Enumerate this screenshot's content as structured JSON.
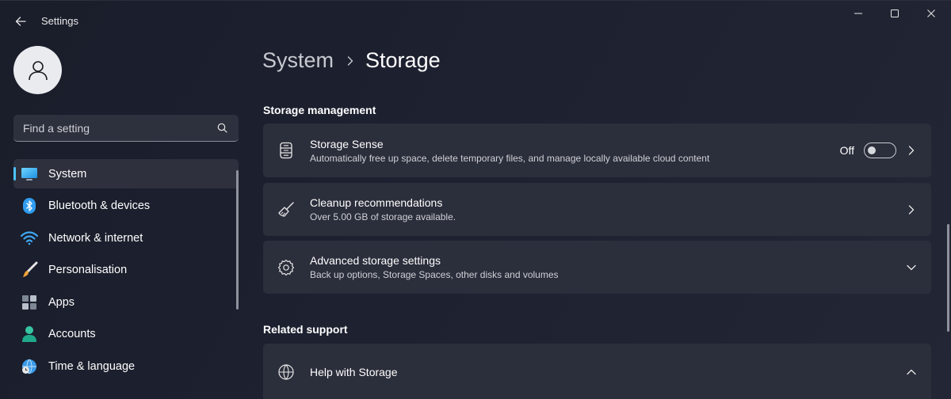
{
  "window": {
    "title": "Settings",
    "controls": [
      "minimize-icon",
      "maximize-icon",
      "close-icon"
    ]
  },
  "sidebar": {
    "search": {
      "placeholder": "Find a setting"
    },
    "items": [
      {
        "label": "System",
        "icon": "monitor-icon",
        "selected": true
      },
      {
        "label": "Bluetooth & devices",
        "icon": "bluetooth-icon",
        "selected": false
      },
      {
        "label": "Network & internet",
        "icon": "wifi-icon",
        "selected": false
      },
      {
        "label": "Personalisation",
        "icon": "paintbrush-icon",
        "selected": false
      },
      {
        "label": "Apps",
        "icon": "apps-icon",
        "selected": false
      },
      {
        "label": "Accounts",
        "icon": "account-icon",
        "selected": false
      },
      {
        "label": "Time & language",
        "icon": "globe-clock-icon",
        "selected": false
      }
    ]
  },
  "breadcrumb": {
    "parent": "System",
    "current": "Storage"
  },
  "storage_management": {
    "heading": "Storage management",
    "storage_sense": {
      "title": "Storage Sense",
      "subtitle": "Automatically free up space, delete temporary files, and manage locally available cloud content",
      "toggle_label": "Off",
      "toggle_on": false
    },
    "cleanup": {
      "title": "Cleanup recommendations",
      "subtitle": "Over 5.00 GB of storage available."
    },
    "advanced": {
      "title": "Advanced storage settings",
      "subtitle": "Back up options, Storage Spaces, other disks and volumes"
    }
  },
  "related_support": {
    "heading": "Related support",
    "help": {
      "title": "Help with Storage"
    }
  },
  "colors": {
    "accent": "#4cc2ff",
    "card_bg": "#2b2e3b",
    "selected_bg": "#2e313d"
  }
}
